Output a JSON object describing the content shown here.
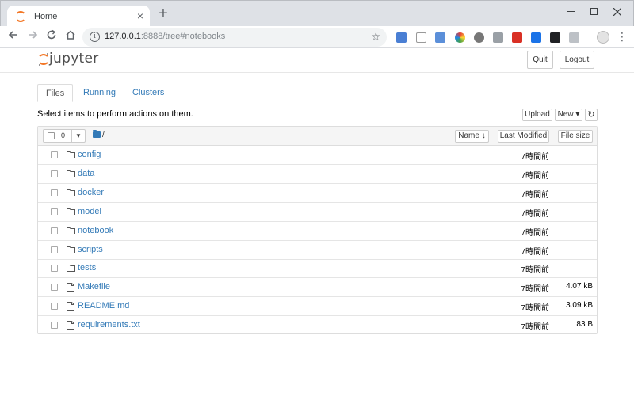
{
  "browser": {
    "tab_title": "Home",
    "tab_close": "×",
    "new_tab": "+",
    "url_host": "127.0.0.1",
    "url_rest": ":8888/tree#notebooks",
    "info_glyph": "i",
    "icons": [
      "back-icon",
      "forward-icon",
      "reload-icon",
      "home-icon",
      "star-icon",
      "profile-avatar-icon",
      "menu-icon"
    ]
  },
  "header": {
    "logo_text": "jupyter",
    "quit_label": "Quit",
    "logout_label": "Logout"
  },
  "tabs": [
    {
      "label": "Files",
      "active": true
    },
    {
      "label": "Running",
      "active": false
    },
    {
      "label": "Clusters",
      "active": false
    }
  ],
  "toolbar": {
    "select_message": "Select items to perform actions on them.",
    "upload_label": "Upload",
    "new_label": "New",
    "new_caret": "▾",
    "refresh_glyph": "↻"
  },
  "list": {
    "selected_count": "0",
    "breadcrumb": "/",
    "sort_name": "Name",
    "sort_name_arrow": "↓",
    "sort_modified": "Last Modified",
    "sort_size": "File size",
    "items": [
      {
        "name": "config",
        "type": "folder",
        "modified": "7時間前",
        "size": ""
      },
      {
        "name": "data",
        "type": "folder",
        "modified": "7時間前",
        "size": ""
      },
      {
        "name": "docker",
        "type": "folder",
        "modified": "7時間前",
        "size": ""
      },
      {
        "name": "model",
        "type": "folder",
        "modified": "7時間前",
        "size": ""
      },
      {
        "name": "notebook",
        "type": "folder",
        "modified": "7時間前",
        "size": ""
      },
      {
        "name": "scripts",
        "type": "folder",
        "modified": "7時間前",
        "size": ""
      },
      {
        "name": "tests",
        "type": "folder",
        "modified": "7時間前",
        "size": ""
      },
      {
        "name": "Makefile",
        "type": "file",
        "modified": "7時間前",
        "size": "4.07 kB"
      },
      {
        "name": "README.md",
        "type": "file",
        "modified": "7時間前",
        "size": "3.09 kB"
      },
      {
        "name": "requirements.txt",
        "type": "file",
        "modified": "7時間前",
        "size": "83 B"
      }
    ]
  },
  "colors": {
    "link": "#337ab7",
    "jupyter_orange": "#f37726",
    "border": "#dddddd"
  }
}
